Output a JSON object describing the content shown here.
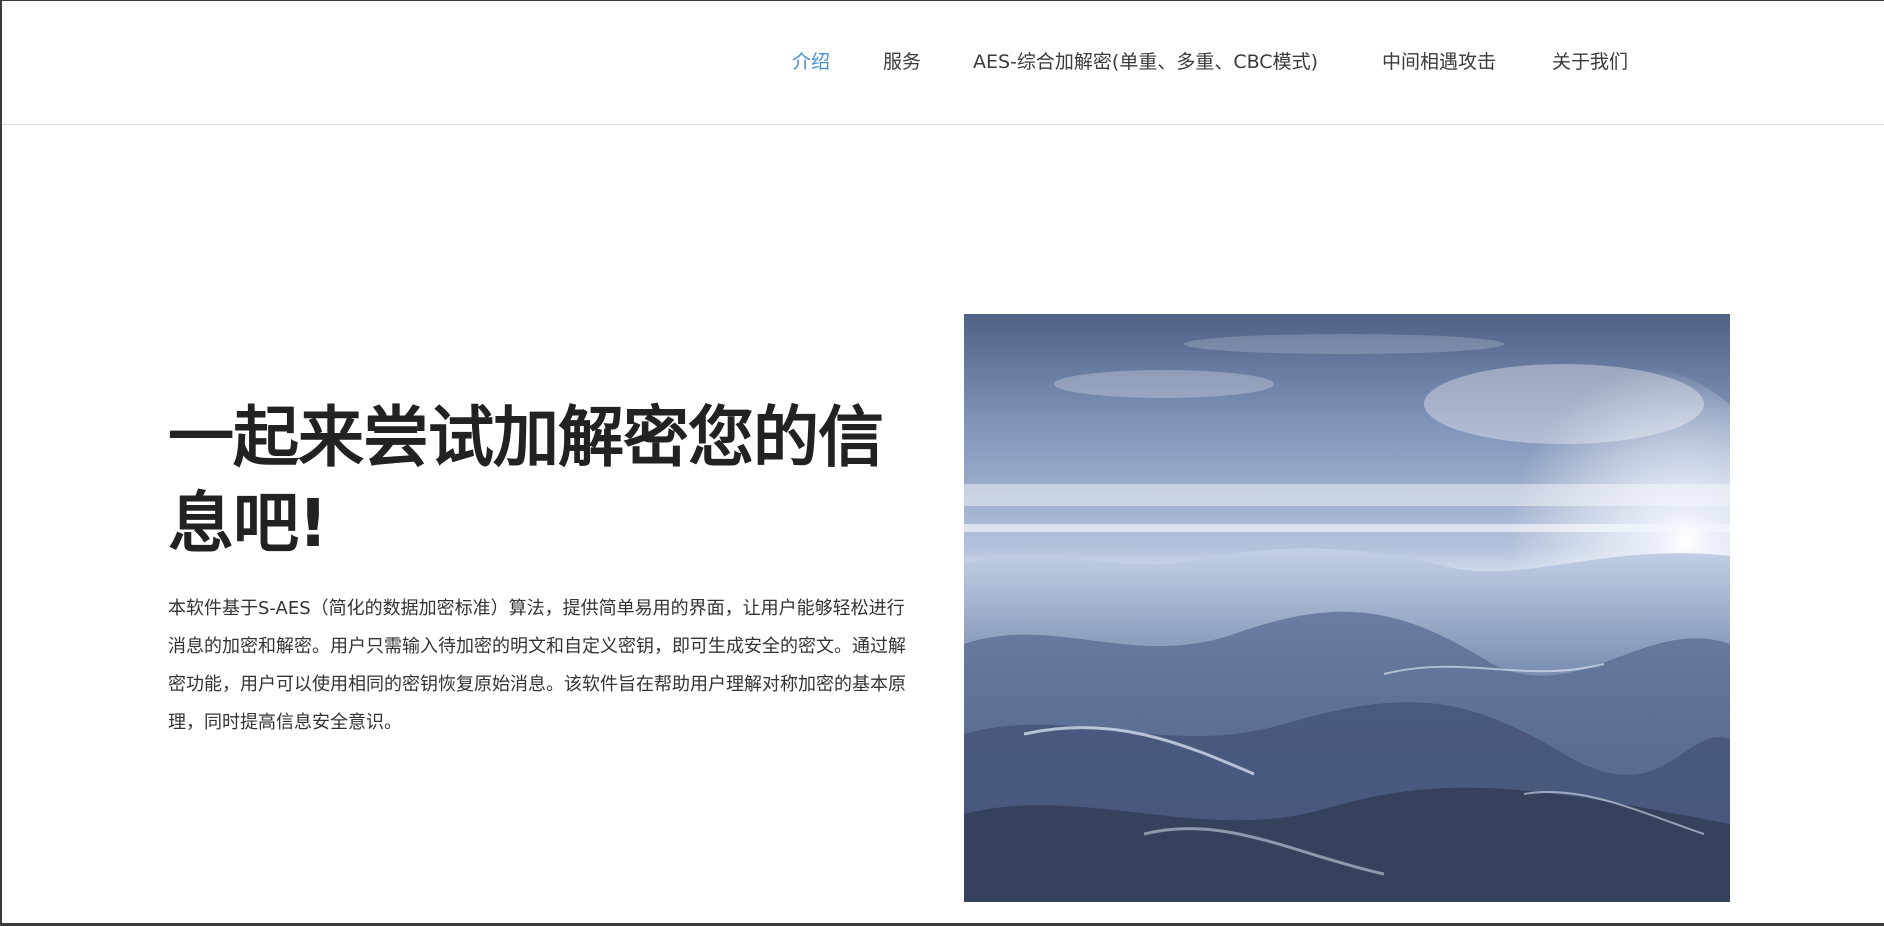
{
  "nav": {
    "items": [
      {
        "label": "介绍",
        "active": true
      },
      {
        "label": "服务"
      },
      {
        "label": "AES-综合加解密(单重、多重、CBC模式)"
      },
      {
        "label": "中间相遇攻击"
      },
      {
        "label": "关于我们"
      }
    ],
    "active_color": "#4a8fd6"
  },
  "hero": {
    "title": "一起来尝试加解密您的信息吧!",
    "description": "本软件基于S-AES（简化的数据加密标准）算法，提供简单易用的界面，让用户能够轻松进行消息的加密和解密。用户只需输入待加密的明文和自定义密钥，即可生成安全的密文。通过解密功能，用户可以使用相同的密钥恢复原始消息。该软件旨在帮助用户理解对称加密的基本原理，同时提高信息安全意识。"
  }
}
